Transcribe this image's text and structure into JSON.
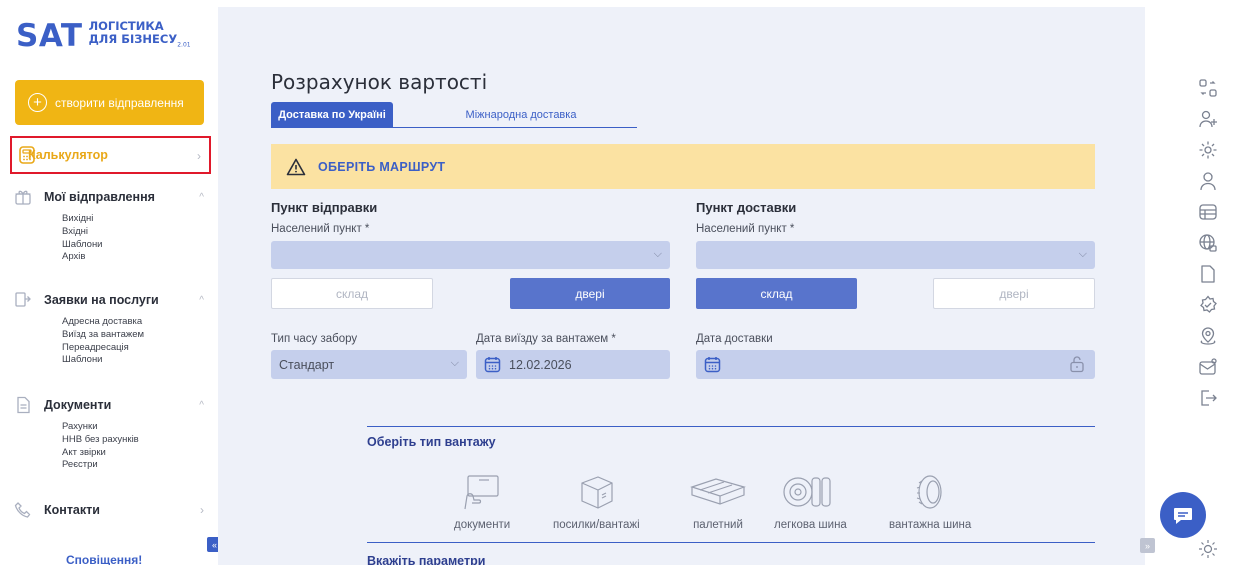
{
  "logo": {
    "brand": "SAT",
    "line1": "ЛОГІСТИКА",
    "line2": "ДЛЯ БІЗНЕСУ",
    "version": "2.01"
  },
  "sidebar": {
    "create_label": "створити відправлення",
    "calculator_label": "Калькулятор",
    "groups": [
      {
        "label": "Мої відправлення",
        "items": [
          "Вихідні",
          "Вхідні",
          "Шаблони",
          "Архів"
        ]
      },
      {
        "label": "Заявки на послуги",
        "items": [
          "Адресна доставка",
          "Виїзд за вантажем",
          "Переадресація",
          "Шаблони"
        ]
      },
      {
        "label": "Документи",
        "items": [
          "Рахунки",
          "ННВ без рахунків",
          "Акт звірки",
          "Реєстри"
        ]
      }
    ],
    "contacts_label": "Контакти",
    "notifications_label": "Сповіщення!",
    "collapse_glyph": "«"
  },
  "main": {
    "title": "Розрахунок вартості",
    "tabs": [
      "Доставка по Україні",
      "Міжнародна доставка"
    ],
    "warning": "ОБЕРІТЬ МАРШРУТ",
    "origin": {
      "title": "Пункт відправки",
      "city_label": "Населений пункт *",
      "btn_warehouse": "склад",
      "btn_door": "двері"
    },
    "destination": {
      "title": "Пункт доставки",
      "city_label": "Населений пункт *",
      "btn_warehouse": "склад",
      "btn_door": "двері"
    },
    "pickup_time": {
      "label": "Тип часу забору",
      "value": "Стандарт"
    },
    "departure_date": {
      "label": "Дата виїзду за вантажем *",
      "value": "12.02.2026"
    },
    "delivery_date": {
      "label": "Дата доставки",
      "value": ""
    },
    "cargo_title": "Оберіть тип вантажу",
    "cargo_types": [
      "документи",
      "посилки/вантажі",
      "палетний",
      "легкова шина",
      "вантажна шина"
    ],
    "params_title": "Вкажіть параметри"
  },
  "right_rail": {
    "icons": [
      "transfer-icon",
      "add-user-icon",
      "settings-icon",
      "user-icon",
      "database-icon",
      "globe-icon",
      "document-icon",
      "gear-badge-icon",
      "location-icon",
      "mail-icon",
      "logout-icon"
    ],
    "expand_glyph": "»"
  },
  "colors": {
    "accent": "#3b5fc6",
    "yellow": "#f0b514",
    "warning_bg": "#fbe2a2",
    "highlight": "#e0192b",
    "panel_bg": "#eef1f9",
    "input_bg": "#c5cfec",
    "button_blue": "#5874cc"
  }
}
